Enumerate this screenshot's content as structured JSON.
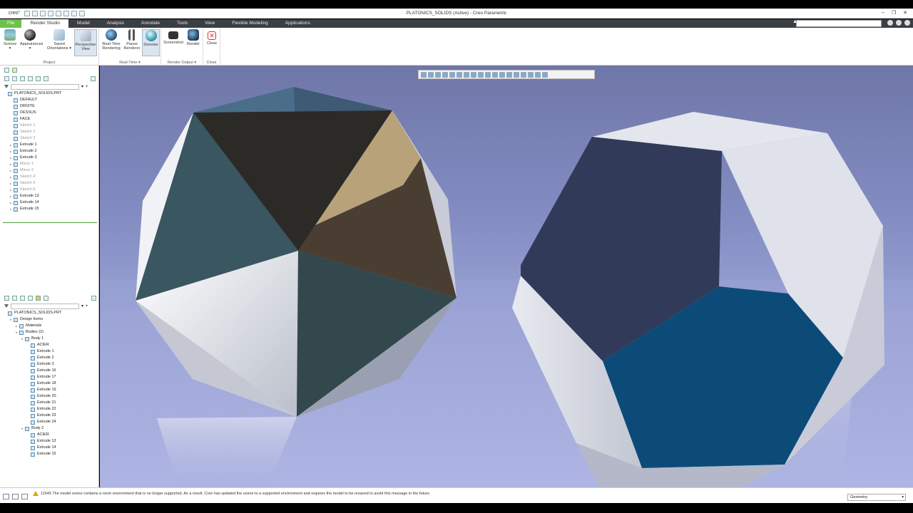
{
  "window": {
    "app_logo": "creo°",
    "title": "PLATONICS_SOLIDS (Active) - Creo Parametric",
    "controls": [
      "–",
      "❐",
      "✕"
    ]
  },
  "menu_tabs": [
    {
      "label": "File",
      "kind": "file"
    },
    {
      "label": "Render Studio",
      "kind": "active"
    },
    {
      "label": "Model",
      "kind": ""
    },
    {
      "label": "Analysis",
      "kind": ""
    },
    {
      "label": "Annotate",
      "kind": ""
    },
    {
      "label": "Tools",
      "kind": ""
    },
    {
      "label": "View",
      "kind": ""
    },
    {
      "label": "Flexible Modeling",
      "kind": ""
    },
    {
      "label": "Applications",
      "kind": ""
    }
  ],
  "ribbon": {
    "project": {
      "group_label": "Project",
      "scenes": "Scenes",
      "appearances": "Appearances",
      "saved_orientations_1": "Saved",
      "saved_orientations_2": "Orientations",
      "perspective_1": "Perspective",
      "perspective_2": "View"
    },
    "realtime": {
      "group_label": "Real-Time ▾",
      "rt_rendering_1": "Real-Time",
      "rt_rendering_2": "Rendering",
      "pause_1": "Pause",
      "pause_2": "Renderer",
      "denoise": "Denoise"
    },
    "render_output": {
      "group_label": "Render Output ▾",
      "screenshot": "Screenshot",
      "render": "Render"
    },
    "close": {
      "group_label": "Close",
      "close": "Close"
    }
  },
  "model_tree": [
    {
      "label": "PLATONICS_SOLIDS.PRT",
      "dim": false,
      "indent": 0,
      "exp": ""
    },
    {
      "label": "DEFAULT",
      "dim": false,
      "indent": 1,
      "exp": ""
    },
    {
      "label": "DROITE",
      "dim": false,
      "indent": 1,
      "exp": ""
    },
    {
      "label": "DESSUS",
      "dim": false,
      "indent": 1,
      "exp": ""
    },
    {
      "label": "FACE",
      "dim": false,
      "indent": 1,
      "exp": ""
    },
    {
      "label": "Sketch 1",
      "dim": true,
      "indent": 1,
      "exp": ""
    },
    {
      "label": "Sketch 2",
      "dim": true,
      "indent": 1,
      "exp": ""
    },
    {
      "label": "Sketch 3",
      "dim": true,
      "indent": 1,
      "exp": ""
    },
    {
      "label": "Extrude 1",
      "dim": false,
      "indent": 1,
      "exp": "▸"
    },
    {
      "label": "Extrude 2",
      "dim": false,
      "indent": 1,
      "exp": "▸"
    },
    {
      "label": "Extrude 3",
      "dim": false,
      "indent": 1,
      "exp": "▸"
    },
    {
      "label": "Mirror 1",
      "dim": true,
      "indent": 1,
      "exp": "▸"
    },
    {
      "label": "Mirror 2",
      "dim": true,
      "indent": 1,
      "exp": "▸"
    },
    {
      "label": "Sketch 4",
      "dim": true,
      "indent": 1,
      "exp": "▸"
    },
    {
      "label": "Sketch 5",
      "dim": true,
      "indent": 1,
      "exp": "▸"
    },
    {
      "label": "Sketch 6",
      "dim": true,
      "indent": 1,
      "exp": "▸"
    },
    {
      "label": "Extrude 13",
      "dim": false,
      "indent": 1,
      "exp": "▸"
    },
    {
      "label": "Extrude 14",
      "dim": false,
      "indent": 1,
      "exp": "▸"
    },
    {
      "label": "Extrude 15",
      "dim": false,
      "indent": 1,
      "exp": "▸"
    }
  ],
  "body_tree": [
    {
      "label": "PLATONICS_SOLIDS.PRT",
      "dim": false,
      "indent": 0,
      "exp": ""
    },
    {
      "label": "Design Items",
      "dim": false,
      "indent": 1,
      "exp": "▾"
    },
    {
      "label": "Materials",
      "dim": false,
      "indent": 2,
      "exp": "▸"
    },
    {
      "label": "Bodies (2)",
      "dim": false,
      "indent": 2,
      "exp": "▾"
    },
    {
      "label": "Body 1",
      "dim": false,
      "indent": 3,
      "exp": "▾"
    },
    {
      "label": "ACIER",
      "dim": false,
      "indent": 4,
      "exp": ""
    },
    {
      "label": "Extrude 1",
      "dim": false,
      "indent": 4,
      "exp": ""
    },
    {
      "label": "Extrude 2",
      "dim": false,
      "indent": 4,
      "exp": ""
    },
    {
      "label": "Extrude 3",
      "dim": false,
      "indent": 4,
      "exp": ""
    },
    {
      "label": "Extrude 16",
      "dim": false,
      "indent": 4,
      "exp": ""
    },
    {
      "label": "Extrude 17",
      "dim": false,
      "indent": 4,
      "exp": ""
    },
    {
      "label": "Extrude 18",
      "dim": false,
      "indent": 4,
      "exp": ""
    },
    {
      "label": "Extrude 19",
      "dim": false,
      "indent": 4,
      "exp": ""
    },
    {
      "label": "Extrude 20",
      "dim": false,
      "indent": 4,
      "exp": ""
    },
    {
      "label": "Extrude 21",
      "dim": false,
      "indent": 4,
      "exp": ""
    },
    {
      "label": "Extrude 22",
      "dim": false,
      "indent": 4,
      "exp": ""
    },
    {
      "label": "Extrude 23",
      "dim": false,
      "indent": 4,
      "exp": ""
    },
    {
      "label": "Extrude 24",
      "dim": false,
      "indent": 4,
      "exp": ""
    },
    {
      "label": "Body 2",
      "dim": false,
      "indent": 3,
      "exp": "▾"
    },
    {
      "label": "ACIER",
      "dim": false,
      "indent": 4,
      "exp": ""
    },
    {
      "label": "Extrude 13",
      "dim": false,
      "indent": 4,
      "exp": ""
    },
    {
      "label": "Extrude 14",
      "dim": false,
      "indent": 4,
      "exp": ""
    },
    {
      "label": "Extrude 15",
      "dim": false,
      "indent": 4,
      "exp": ""
    }
  ],
  "status": {
    "message": "11545 The model scene contains a room environment that is no longer supported. As a result, Creo has updated the scene to a supported environment and requires the model to be resaved to avoid this message in the future.",
    "selection_filter": "Geometry"
  },
  "colors": {
    "file_tab": "#6cc24a",
    "menubar": "#3a3f44",
    "tree_divider": "#4c9a3a"
  }
}
